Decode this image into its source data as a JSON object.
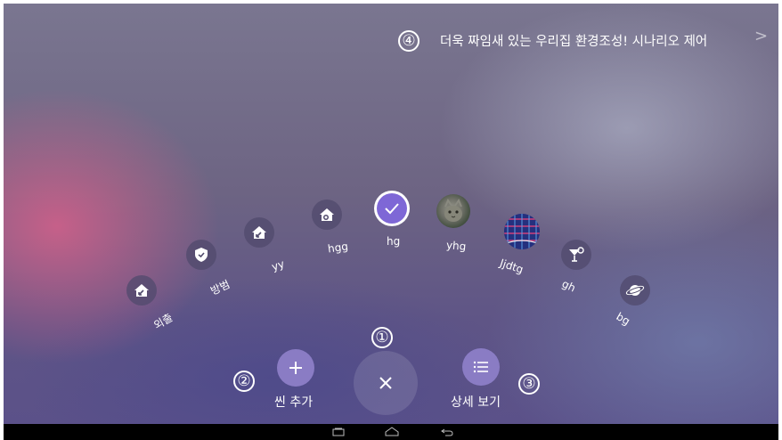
{
  "header": {
    "promo_text": "더욱 짜임새 있는 우리집 환경조성! 시나리오 제어",
    "chevron": ">",
    "badge_4": "④"
  },
  "scenes": [
    {
      "label": "외출",
      "icon": "home-arrow-icon"
    },
    {
      "label": "방범",
      "icon": "shield-check-icon"
    },
    {
      "label": "yy",
      "icon": "home-arrow-icon"
    },
    {
      "label": "hgg",
      "icon": "home-clock-icon"
    },
    {
      "label": "hg",
      "icon": "check-icon",
      "selected": true
    },
    {
      "label": "yhg",
      "icon": "cat-photo-thumbnail"
    },
    {
      "label": "Jjdtg",
      "icon": "pattern-photo-thumbnail"
    },
    {
      "label": "gh",
      "icon": "cocktail-icon"
    },
    {
      "label": "bg",
      "icon": "planet-icon"
    }
  ],
  "actions": {
    "badge_1": "①",
    "badge_2": "②",
    "badge_3": "③",
    "add_scene_label": "씬 추가",
    "details_label": "상세 보기"
  },
  "colors": {
    "selected_scene": "#7e67d6",
    "action_button": "#8a7cc4",
    "close_button": "rgba(255,255,255,0.12)"
  }
}
